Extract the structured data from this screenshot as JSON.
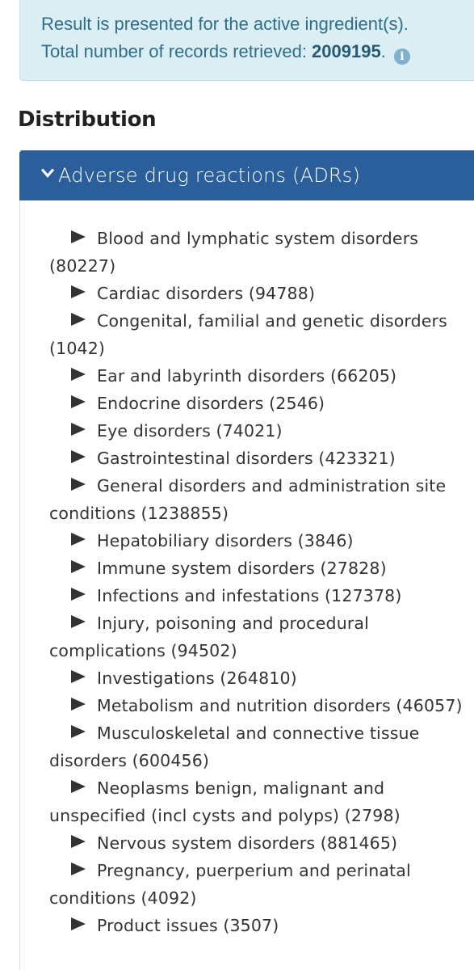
{
  "info": {
    "line1": "Result is presented for the active ingredient(s).",
    "line2_prefix": "Total number of records retrieved: ",
    "total_records": "2009195",
    "line2_suffix": ".",
    "info_icon": "info-circle-icon"
  },
  "distribution": {
    "title": "Distribution"
  },
  "panel": {
    "title": "Adverse drug reactions (ADRs)",
    "toggle_icon": "chevron-down-icon",
    "header_color": "#2b5f9c"
  },
  "soc_items": [
    {
      "label": "Blood and lymphatic system disorders",
      "count": "(80227)"
    },
    {
      "label": "Cardiac disorders",
      "count": "(94788)"
    },
    {
      "label": "Congenital, familial and genetic disorders",
      "count": "(1042)"
    },
    {
      "label": "Ear and labyrinth disorders",
      "count": "(66205)"
    },
    {
      "label": "Endocrine disorders",
      "count": "(2546)"
    },
    {
      "label": "Eye disorders",
      "count": "(74021)"
    },
    {
      "label": "Gastrointestinal disorders",
      "count": "(423321)"
    },
    {
      "label": "General disorders and administration site conditions",
      "count": "(1238855)"
    },
    {
      "label": "Hepatobiliary disorders",
      "count": "(3846)"
    },
    {
      "label": "Immune system disorders",
      "count": "(27828)"
    },
    {
      "label": "Infections and infestations",
      "count": "(127378)"
    },
    {
      "label": "Injury, poisoning and procedural complications",
      "count": "(94502)"
    },
    {
      "label": "Investigations",
      "count": "(264810)"
    },
    {
      "label": "Metabolism and nutrition disorders",
      "count": "(46057)"
    },
    {
      "label": "Musculoskeletal and connective tissue disorders",
      "count": "(600456)"
    },
    {
      "label": "Neoplasms benign, malignant and unspecified (incl cysts and polyps)",
      "count": "(2798)"
    },
    {
      "label": "Nervous system disorders",
      "count": "(881465)"
    },
    {
      "label": "Pregnancy, puerperium and perinatal conditions",
      "count": "(4092)"
    },
    {
      "label": "Product issues",
      "count": "(3507)"
    }
  ],
  "expand_icon": "triangle-right-icon"
}
